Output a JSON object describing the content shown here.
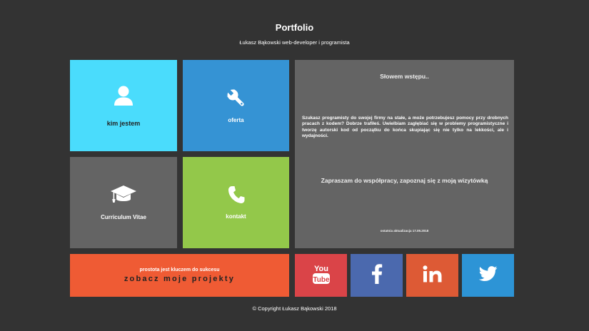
{
  "header": {
    "title": "Portfolio",
    "subtitle": "Łukasz Bąkowski web-developer i programista"
  },
  "tiles": {
    "about": {
      "label": "kim jestem",
      "icon": "user-icon",
      "color": "#4adcfc"
    },
    "offer": {
      "label": "oferta",
      "icon": "wrench-icon",
      "color": "#3593d4"
    },
    "cv": {
      "label": "Curriculum Vitae",
      "icon": "graduation-cap-icon",
      "color": "#646464"
    },
    "contact": {
      "label": "kontakt",
      "icon": "phone-icon",
      "color": "#93c84a"
    }
  },
  "intro": {
    "heading": "Słowem wstępu..",
    "text": "Szukasz programisty do swojej firmy na stałe, a może potrzebujesz pomocy przy drobnych pracach z kodem? Dobrze trafiłeś. Uwielbiam zagłębiać się w problemy programistyczne i tworzę autorski kod od początku do końca skupiając się nie tylko na lekkości, ale i wydajności.",
    "cta": "Zapraszam do współpracy, zapoznaj się z moją wizytówką",
    "updated": "ostatnia aktualizacja 17.09.2018"
  },
  "projects": {
    "tagline": "prostota jest kluczem do sukcesu",
    "link": "zobacz moje projekty",
    "color": "#ef5b34"
  },
  "social": [
    {
      "icon": "youtube-icon",
      "text": "You\nTube",
      "color": "#da4448"
    },
    {
      "icon": "facebook-icon",
      "color": "#4b69ae"
    },
    {
      "icon": "linkedin-icon",
      "text": "in",
      "color": "#dd5a35"
    },
    {
      "icon": "twitter-icon",
      "color": "#2d94d6"
    }
  ],
  "footer": {
    "copyright": "© Copyright Łukasz Bąkowski 2018"
  }
}
